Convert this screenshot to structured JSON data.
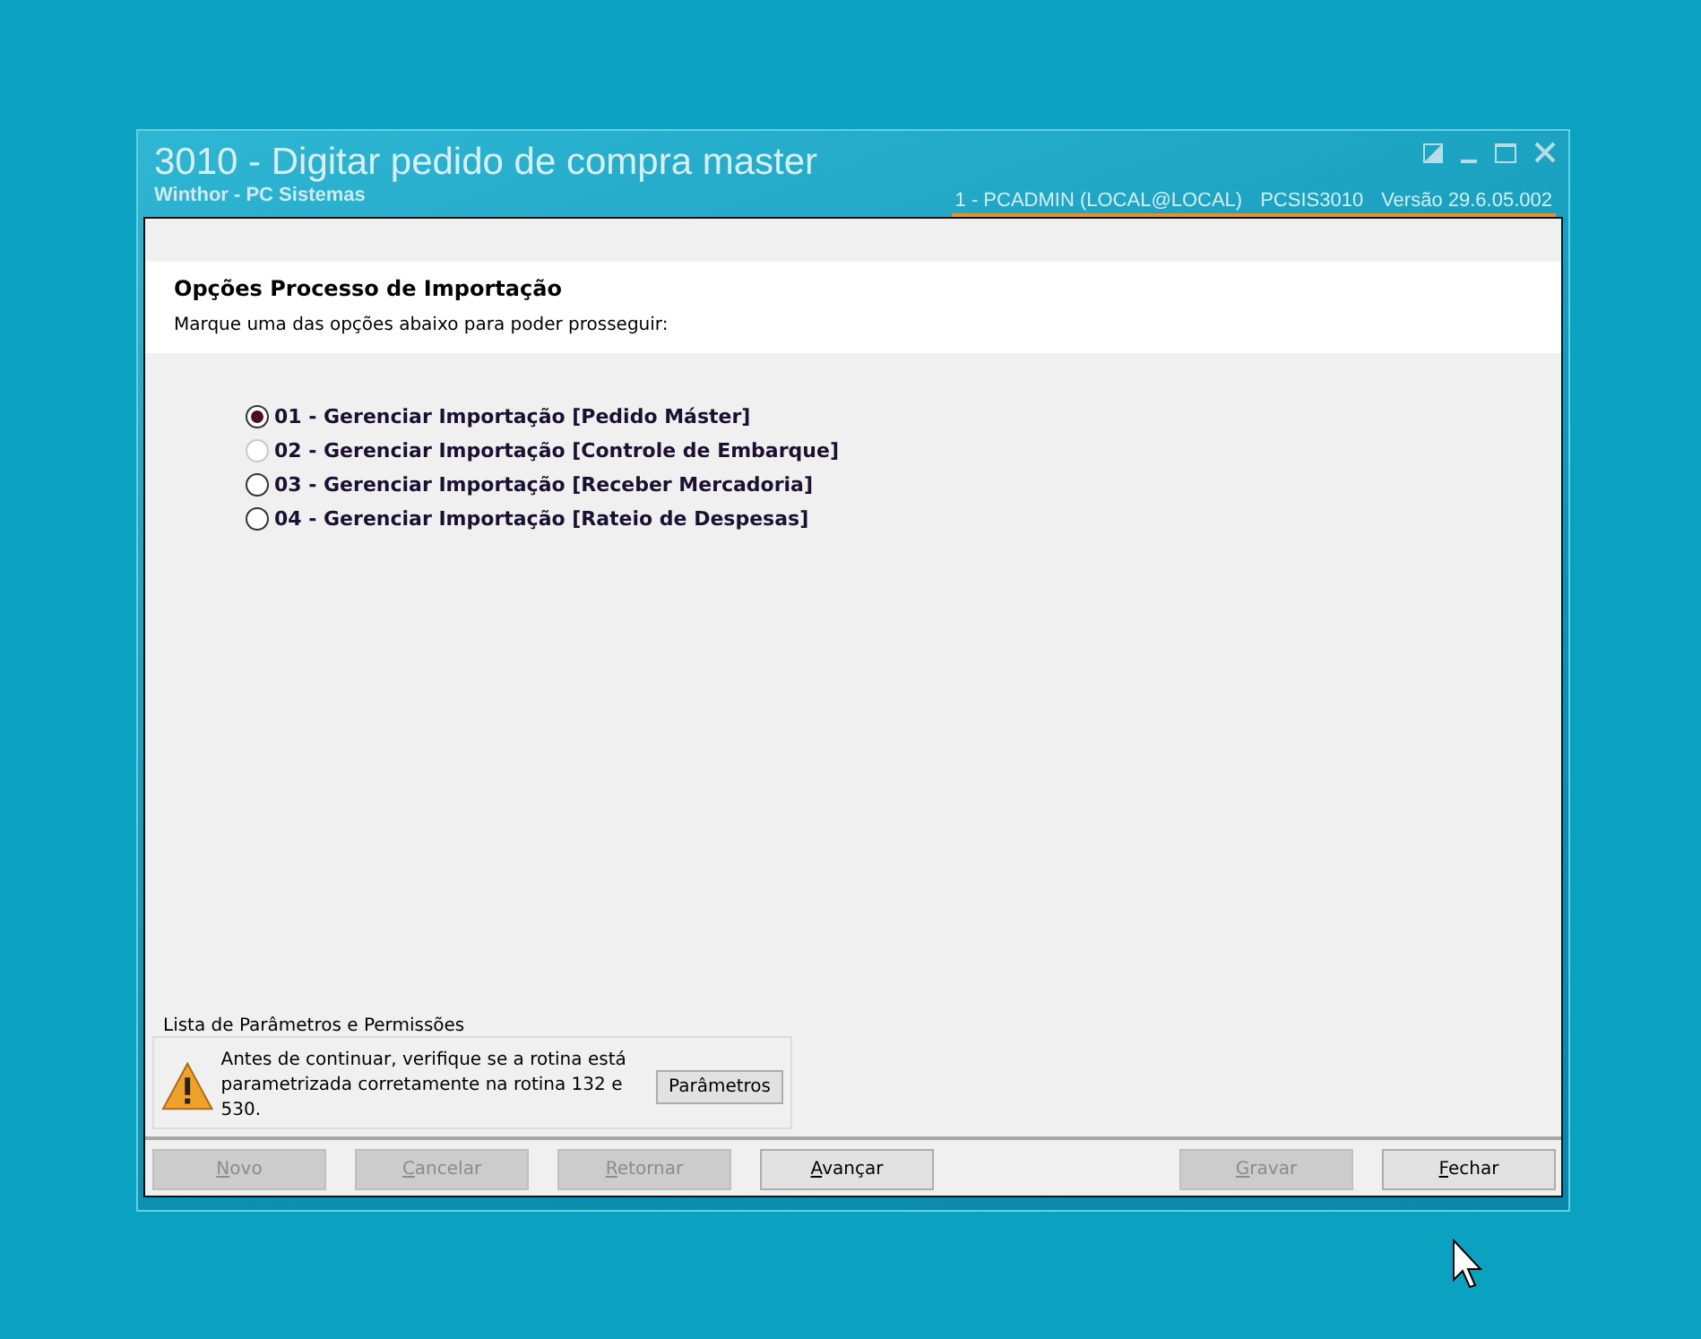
{
  "window": {
    "title": "3010 - Digitar pedido de compra master",
    "subtitle": "Winthor - PC Sistemas",
    "session": "1 - PCADMIN (LOCAL@LOCAL)",
    "program": "PCSIS3010",
    "version": "Versão  29.6.05.002"
  },
  "header": {
    "title": "Opções Processo de Importação",
    "instruction": "Marque uma das opções abaixo para poder prosseguir:"
  },
  "options": [
    {
      "label": "01 - Gerenciar Importação [Pedido Máster]",
      "selected": true,
      "disabled": false
    },
    {
      "label": "02 - Gerenciar Importação [Controle de Embarque]",
      "selected": false,
      "disabled": true
    },
    {
      "label": "03 - Gerenciar Importação [Receber Mercadoria]",
      "selected": false,
      "disabled": false
    },
    {
      "label": "04 - Gerenciar Importação [Rateio de Despesas]",
      "selected": false,
      "disabled": false
    }
  ],
  "parameters_group": {
    "title": "Lista de Parâmetros e Permissões",
    "message": "Antes de continuar, verifique se a rotina está parametrizada corretamente na rotina 132 e 530.",
    "button": "Parâmetros"
  },
  "buttons_left": [
    {
      "label": "Novo",
      "disabled": true
    },
    {
      "label": "Cancelar",
      "disabled": true
    },
    {
      "label": "Retornar",
      "disabled": true
    },
    {
      "label": "Avançar",
      "disabled": false
    }
  ],
  "buttons_right": [
    {
      "label": "Gravar",
      "disabled": true
    },
    {
      "label": "Fechar",
      "disabled": false
    }
  ]
}
